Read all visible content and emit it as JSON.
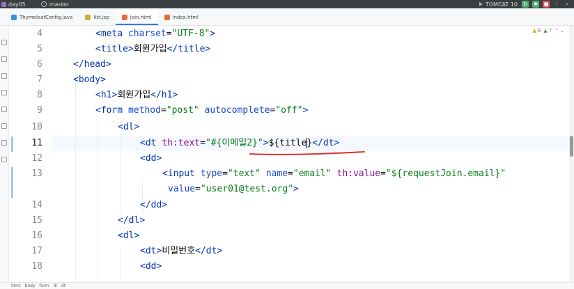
{
  "titlebar": {
    "project": "day05",
    "branch": "master",
    "run_config": "TOMCAT 10"
  },
  "tabs": [
    {
      "label": "ThymeleafConfig.java",
      "icon": "java-class-icon",
      "color": "#3d8fd6",
      "active": false
    },
    {
      "label": "list.jsp",
      "icon": "jsp-file-icon",
      "color": "#c9b03b",
      "active": false
    },
    {
      "label": "join.html",
      "icon": "html-file-icon",
      "color": "#e0703a",
      "active": true
    },
    {
      "label": "index.html",
      "icon": "html-file-icon",
      "color": "#e0703a",
      "active": false
    }
  ],
  "inspections": {
    "warnings": "8",
    "ok": "7"
  },
  "lines": [
    {
      "number": "4",
      "current": false
    },
    {
      "number": "5",
      "current": false
    },
    {
      "number": "6",
      "current": false
    },
    {
      "number": "7",
      "current": false
    },
    {
      "number": "8",
      "current": false
    },
    {
      "number": "9",
      "current": false
    },
    {
      "number": "10",
      "current": false
    },
    {
      "number": "11",
      "current": true
    },
    {
      "number": "12",
      "current": false
    },
    {
      "number": "13",
      "current": false
    },
    {
      "number": "",
      "current": false
    },
    {
      "number": "14",
      "current": false
    },
    {
      "number": "15",
      "current": false
    },
    {
      "number": "16",
      "current": false
    },
    {
      "number": "17",
      "current": false
    },
    {
      "number": "18",
      "current": false
    }
  ],
  "code": {
    "l4": {
      "open": "<meta ",
      "a1": "charset",
      "eq": "=",
      "v1": "\"UTF-8\"",
      "close": ">"
    },
    "l5": {
      "open": "<title",
      "gt": ">",
      "text": "회원가입",
      "end": "</title>"
    },
    "l6": {
      "open": "</",
      "name": "head",
      "close": ">"
    },
    "l7": {
      "open": "<",
      "name": "body",
      "close": ">"
    },
    "l8": {
      "open": "<h1",
      "gt": ">",
      "text": "회원가입",
      "end": "</h1>"
    },
    "l9": {
      "open": "<form ",
      "a1": "method",
      "v1": "\"post\"",
      "a2": "autocomplete",
      "v2": "\"off\"",
      "close": ">"
    },
    "l10": {
      "open": "<dl",
      "close": ">"
    },
    "l11": {
      "open": "<dt ",
      "a1": "th:text",
      "v1": "\"#{이메일2}\"",
      "gt": ">",
      "text": "${title",
      "text2": "}",
      "end": "</dt>"
    },
    "l12": {
      "open": "<dd",
      "close": ">"
    },
    "l13": {
      "open": "<input ",
      "a1": "type",
      "v1": "\"text\"",
      "a2": "name",
      "v2": "\"email\"",
      "a3": "th:value",
      "v3": "\"${requestJoin.email}\""
    },
    "l13b": {
      "a4": "value",
      "v4": "\"user01@test.org\"",
      "close": ">"
    },
    "l14": {
      "open": "</dd",
      "close": ">"
    },
    "l15": {
      "open": "</dl",
      "close": ">"
    },
    "l16": {
      "open": "<dl",
      "close": ">"
    },
    "l17": {
      "open": "<dt",
      "gt": ">",
      "text": "비밀번호",
      "end": "</dt>"
    },
    "l18": {
      "open": "<dd",
      "close": ">"
    }
  },
  "annotation_color": "#e0302a",
  "breadcrumb": [
    "html",
    "body",
    "form",
    "dl",
    "dt"
  ]
}
